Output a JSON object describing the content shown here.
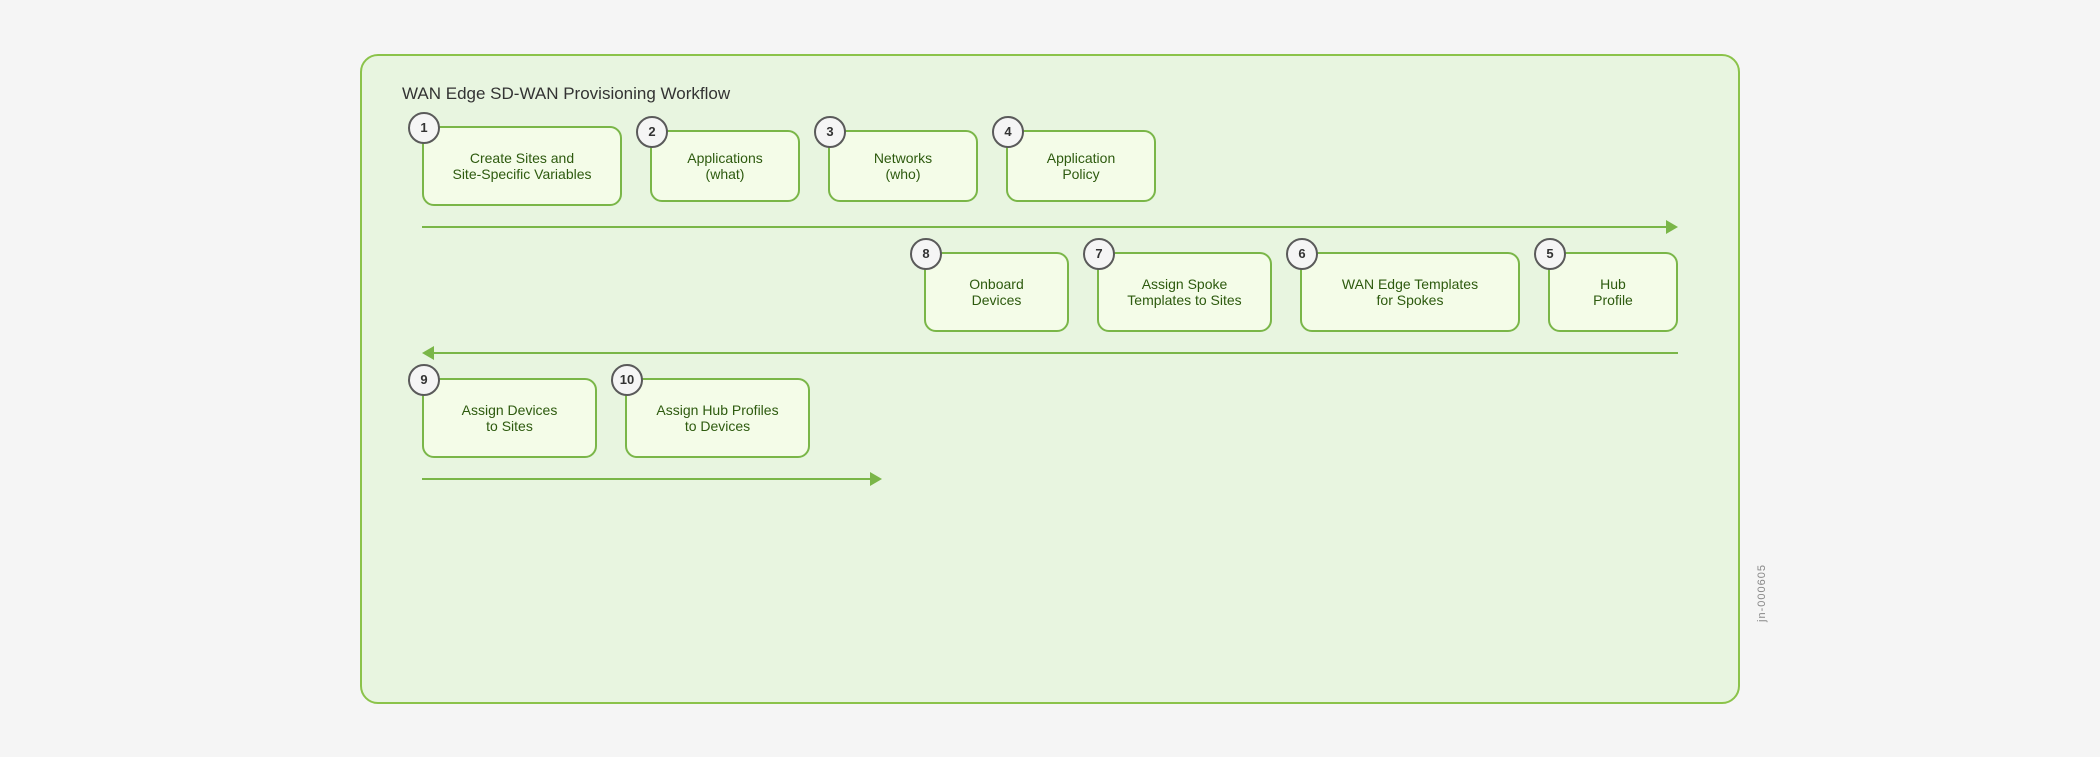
{
  "diagram": {
    "title": "WAN Edge SD-WAN Provisioning Workflow",
    "watermark": "jn-000605",
    "row1": [
      {
        "number": "1",
        "label": "Create Sites and\nSite-Specific Variables"
      },
      {
        "number": "2",
        "label": "Applications\n(what)"
      },
      {
        "number": "3",
        "label": "Networks\n(who)"
      },
      {
        "number": "4",
        "label": "Application\nPolicy"
      }
    ],
    "row2": [
      {
        "number": "8",
        "label": "Onboard\nDevices"
      },
      {
        "number": "7",
        "label": "Assign Spoke\nTemplates to Sites"
      },
      {
        "number": "6",
        "label": "WAN Edge Templates\nfor Spokes"
      },
      {
        "number": "5",
        "label": "Hub\nProfile"
      }
    ],
    "row3": [
      {
        "number": "9",
        "label": "Assign Devices\nto Sites"
      },
      {
        "number": "10",
        "label": "Assign Hub Profiles\nto Devices"
      }
    ]
  }
}
